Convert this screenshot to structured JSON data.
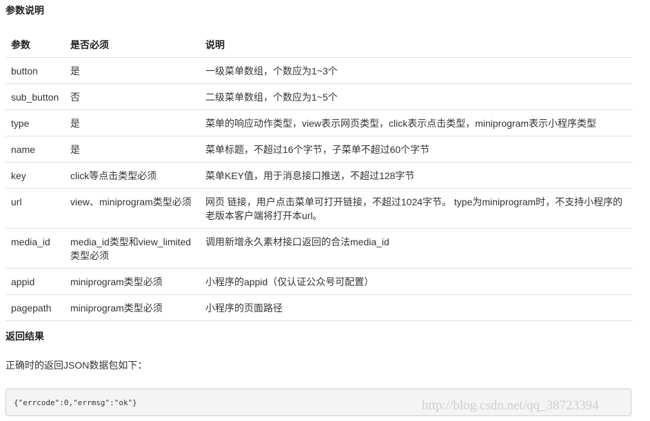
{
  "section1_title": "参数说明",
  "table": {
    "headers": [
      "参数",
      "是否必须",
      "说明"
    ],
    "rows": [
      [
        "button",
        "是",
        "一级菜单数组，个数应为1~3个"
      ],
      [
        "sub_button",
        "否",
        "二级菜单数组，个数应为1~5个"
      ],
      [
        "type",
        "是",
        "菜单的响应动作类型，view表示网页类型，click表示点击类型，miniprogram表示小程序类型"
      ],
      [
        "name",
        "是",
        "菜单标题，不超过16个字节，子菜单不超过60个字节"
      ],
      [
        "key",
        "click等点击类型必须",
        "菜单KEY值，用于消息接口推送，不超过128字节"
      ],
      [
        "url",
        "view、miniprogram类型必须",
        "网页 链接，用户点击菜单可打开链接，不超过1024字节。 type为miniprogram时，不支持小程序的老版本客户端将打开本url。"
      ],
      [
        "media_id",
        "media_id类型和view_limited类型必须",
        "调用新增永久素材接口返回的合法media_id"
      ],
      [
        "appid",
        "miniprogram类型必须",
        "小程序的appid（仅认证公众号可配置）"
      ],
      [
        "pagepath",
        "miniprogram类型必须",
        "小程序的页面路径"
      ]
    ]
  },
  "section2_title": "返回结果",
  "intro": "正确时的返回JSON数据包如下：",
  "code": "{\"errcode\":0,\"errmsg\":\"ok\"}",
  "watermark": "http://blog.csdn.net/qq_38723394"
}
